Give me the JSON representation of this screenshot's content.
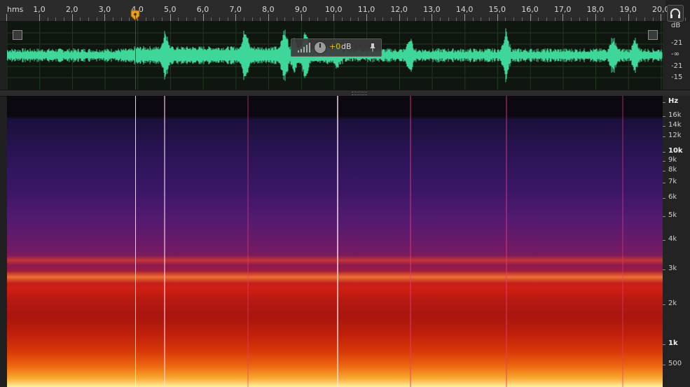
{
  "ruler": {
    "unit": "hms",
    "ticks": [
      "1,0",
      "2,0",
      "3,0",
      "4,0",
      "5,0",
      "6,0",
      "7,0",
      "8,0",
      "9,0",
      "10,0",
      "11,0",
      "12,0",
      "13,0",
      "14,0",
      "15,0",
      "16,0",
      "17,0",
      "18,0",
      "19,0",
      "20,0"
    ]
  },
  "db_scale": {
    "labels": [
      "dB",
      "-21",
      "-∞",
      "-21",
      "-15"
    ]
  },
  "hud": {
    "gain_value": "+0",
    "gain_unit": "dB"
  },
  "hz_scale": {
    "labels": [
      "Hz",
      "16k",
      "14k",
      "12k",
      "10k",
      "9k",
      "8k",
      "7k",
      "6k",
      "5k",
      "4k",
      "3k",
      "2k",
      "1k",
      "500"
    ],
    "bold": [
      "Hz",
      "10k",
      "1k"
    ]
  },
  "colors": {
    "waveform": "#3fd69a",
    "playhead": "#d01010",
    "accent_gain": "#e0c020",
    "background": "#202020"
  },
  "icons": {
    "monitor": "headphones-icon",
    "pin": "pin-icon",
    "meter": "level-meter-icon",
    "knob": "gain-knob-icon",
    "playhead": "playhead-marker-icon"
  }
}
